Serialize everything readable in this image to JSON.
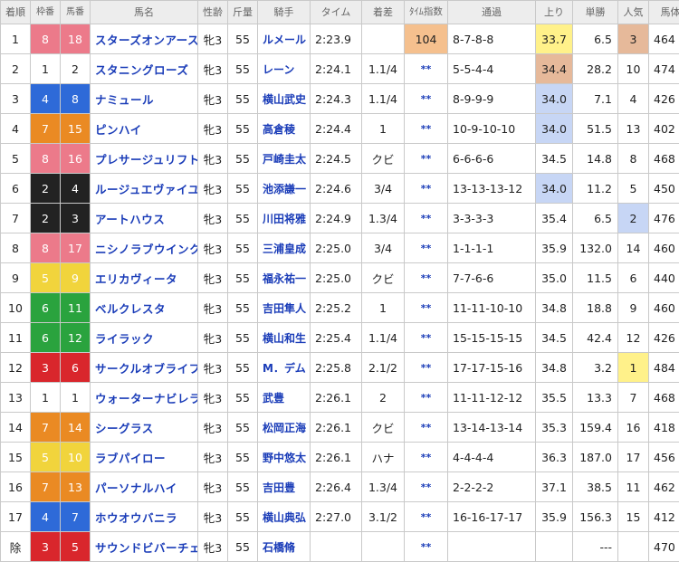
{
  "headers": [
    "着順",
    "枠番",
    "馬番",
    "馬名",
    "性齢",
    "斤量",
    "騎手",
    "タイム",
    "着差",
    "ﾀｲﾑ指数",
    "通過",
    "上り",
    "単勝",
    "人気",
    "馬体重"
  ],
  "frame_colors": {
    "1": {
      "bg": "#ffffff",
      "fg": "#222222"
    },
    "2": {
      "bg": "#222222",
      "fg": "#ffffff"
    },
    "3": {
      "bg": "#d9262c",
      "fg": "#ffffff"
    },
    "4": {
      "bg": "#2e6ad8",
      "fg": "#ffffff"
    },
    "5": {
      "bg": "#f1d43c",
      "fg": "#ffffff"
    },
    "6": {
      "bg": "#2aa33e",
      "fg": "#ffffff"
    },
    "7": {
      "bg": "#ea8a23",
      "fg": "#ffffff"
    },
    "8": {
      "bg": "#ec7a8a",
      "fg": "#ffffff"
    }
  },
  "rows": [
    {
      "rank": "1",
      "waku": "8",
      "num": "18",
      "name": "スターズオンアース",
      "sex_age": "牝3",
      "weight": "55",
      "jockey": "ルメール",
      "time": "2:23.9",
      "margin": "",
      "index": "104",
      "index_hl": "orange",
      "passage": "8-7-8-8",
      "last3f": "33.7",
      "last3f_hl": "yellow",
      "odds": "6.5",
      "pop": "3",
      "pop_hl": "tan",
      "body": "464"
    },
    {
      "rank": "2",
      "waku": "1",
      "num": "2",
      "name": "スタニングローズ",
      "sex_age": "牝3",
      "weight": "55",
      "jockey": "レーン",
      "time": "2:24.1",
      "margin": "1.1/4",
      "index": "**",
      "passage": "5-5-4-4",
      "last3f": "34.4",
      "last3f_hl": "tan",
      "odds": "28.2",
      "pop": "10",
      "body": "474"
    },
    {
      "rank": "3",
      "waku": "4",
      "num": "8",
      "name": "ナミュール",
      "sex_age": "牝3",
      "weight": "55",
      "jockey": "横山武史",
      "time": "2:24.3",
      "margin": "1.1/4",
      "index": "**",
      "passage": "8-9-9-9",
      "last3f": "34.0",
      "last3f_hl": "blue",
      "odds": "7.1",
      "pop": "4",
      "body": "426"
    },
    {
      "rank": "4",
      "waku": "7",
      "num": "15",
      "name": "ピンハイ",
      "sex_age": "牝3",
      "weight": "55",
      "jockey": "高倉稜",
      "time": "2:24.4",
      "margin": "1",
      "index": "**",
      "passage": "10-9-10-10",
      "last3f": "34.0",
      "last3f_hl": "blue",
      "odds": "51.5",
      "pop": "13",
      "body": "402"
    },
    {
      "rank": "5",
      "waku": "8",
      "num": "16",
      "name": "プレサージュリフト",
      "sex_age": "牝3",
      "weight": "55",
      "jockey": "戸崎圭太",
      "time": "2:24.5",
      "margin": "クビ",
      "index": "**",
      "passage": "6-6-6-6",
      "last3f": "34.5",
      "odds": "14.8",
      "pop": "8",
      "body": "468"
    },
    {
      "rank": "6",
      "waku": "2",
      "num": "4",
      "name": "ルージュエヴァイユ",
      "sex_age": "牝3",
      "weight": "55",
      "jockey": "池添謙一",
      "time": "2:24.6",
      "margin": "3/4",
      "index": "**",
      "passage": "13-13-13-12",
      "last3f": "34.0",
      "last3f_hl": "blue",
      "odds": "11.2",
      "pop": "5",
      "body": "450"
    },
    {
      "rank": "7",
      "waku": "2",
      "num": "3",
      "name": "アートハウス",
      "sex_age": "牝3",
      "weight": "55",
      "jockey": "川田将雅",
      "time": "2:24.9",
      "margin": "1.3/4",
      "index": "**",
      "passage": "3-3-3-3",
      "last3f": "35.4",
      "odds": "6.5",
      "pop": "2",
      "pop_hl": "blue",
      "body": "476"
    },
    {
      "rank": "8",
      "waku": "8",
      "num": "17",
      "name": "ニシノラブウインク",
      "sex_age": "牝3",
      "weight": "55",
      "jockey": "三浦皇成",
      "time": "2:25.0",
      "margin": "3/4",
      "index": "**",
      "passage": "1-1-1-1",
      "last3f": "35.9",
      "odds": "132.0",
      "pop": "14",
      "body": "460"
    },
    {
      "rank": "9",
      "waku": "5",
      "num": "9",
      "name": "エリカヴィータ",
      "sex_age": "牝3",
      "weight": "55",
      "jockey": "福永祐一",
      "time": "2:25.0",
      "margin": "クビ",
      "index": "**",
      "passage": "7-7-6-6",
      "last3f": "35.0",
      "odds": "11.5",
      "pop": "6",
      "body": "440"
    },
    {
      "rank": "10",
      "waku": "6",
      "num": "11",
      "name": "ベルクレスタ",
      "sex_age": "牝3",
      "weight": "55",
      "jockey": "吉田隼人",
      "time": "2:25.2",
      "margin": "1",
      "index": "**",
      "passage": "11-11-10-10",
      "last3f": "34.8",
      "odds": "18.8",
      "pop": "9",
      "body": "460"
    },
    {
      "rank": "11",
      "waku": "6",
      "num": "12",
      "name": "ライラック",
      "sex_age": "牝3",
      "weight": "55",
      "jockey": "横山和生",
      "time": "2:25.4",
      "margin": "1.1/4",
      "index": "**",
      "passage": "15-15-15-15",
      "last3f": "34.5",
      "odds": "42.4",
      "pop": "12",
      "body": "426"
    },
    {
      "rank": "12",
      "waku": "3",
      "num": "6",
      "name": "サークルオブライフ",
      "sex_age": "牝3",
      "weight": "55",
      "jockey": "M．デム",
      "time": "2:25.8",
      "margin": "2.1/2",
      "index": "**",
      "passage": "17-17-15-16",
      "last3f": "34.8",
      "odds": "3.2",
      "pop": "1",
      "pop_hl": "yellow",
      "body": "484"
    },
    {
      "rank": "13",
      "waku": "1",
      "num": "1",
      "name": "ウォーターナビレラ",
      "sex_age": "牝3",
      "weight": "55",
      "jockey": "武豊",
      "time": "2:26.1",
      "margin": "2",
      "index": "**",
      "passage": "11-11-12-12",
      "last3f": "35.5",
      "odds": "13.3",
      "pop": "7",
      "body": "468"
    },
    {
      "rank": "14",
      "waku": "7",
      "num": "14",
      "name": "シーグラス",
      "sex_age": "牝3",
      "weight": "55",
      "jockey": "松岡正海",
      "time": "2:26.1",
      "margin": "クビ",
      "index": "**",
      "passage": "13-14-13-14",
      "last3f": "35.3",
      "odds": "159.4",
      "pop": "16",
      "body": "418"
    },
    {
      "rank": "15",
      "waku": "5",
      "num": "10",
      "name": "ラブパイロー",
      "sex_age": "牝3",
      "weight": "55",
      "jockey": "野中悠太",
      "time": "2:26.1",
      "margin": "ハナ",
      "index": "**",
      "passage": "4-4-4-4",
      "last3f": "36.3",
      "odds": "187.0",
      "pop": "17",
      "body": "456"
    },
    {
      "rank": "16",
      "waku": "7",
      "num": "13",
      "name": "パーソナルハイ",
      "sex_age": "牝3",
      "weight": "55",
      "jockey": "吉田豊",
      "time": "2:26.4",
      "margin": "1.3/4",
      "index": "**",
      "passage": "2-2-2-2",
      "last3f": "37.1",
      "odds": "38.5",
      "pop": "11",
      "body": "462"
    },
    {
      "rank": "17",
      "waku": "4",
      "num": "7",
      "name": "ホウオウバニラ",
      "sex_age": "牝3",
      "weight": "55",
      "jockey": "横山典弘",
      "time": "2:27.0",
      "margin": "3.1/2",
      "index": "**",
      "passage": "16-16-17-17",
      "last3f": "35.9",
      "odds": "156.3",
      "pop": "15",
      "body": "412"
    },
    {
      "rank": "除",
      "waku": "3",
      "num": "5",
      "name": "サウンドビバーチェ",
      "sex_age": "牝3",
      "weight": "55",
      "jockey": "石橋脩",
      "time": "",
      "margin": "",
      "index": "**",
      "passage": "",
      "last3f": "",
      "odds": "---",
      "pop": "",
      "body": "470"
    }
  ]
}
